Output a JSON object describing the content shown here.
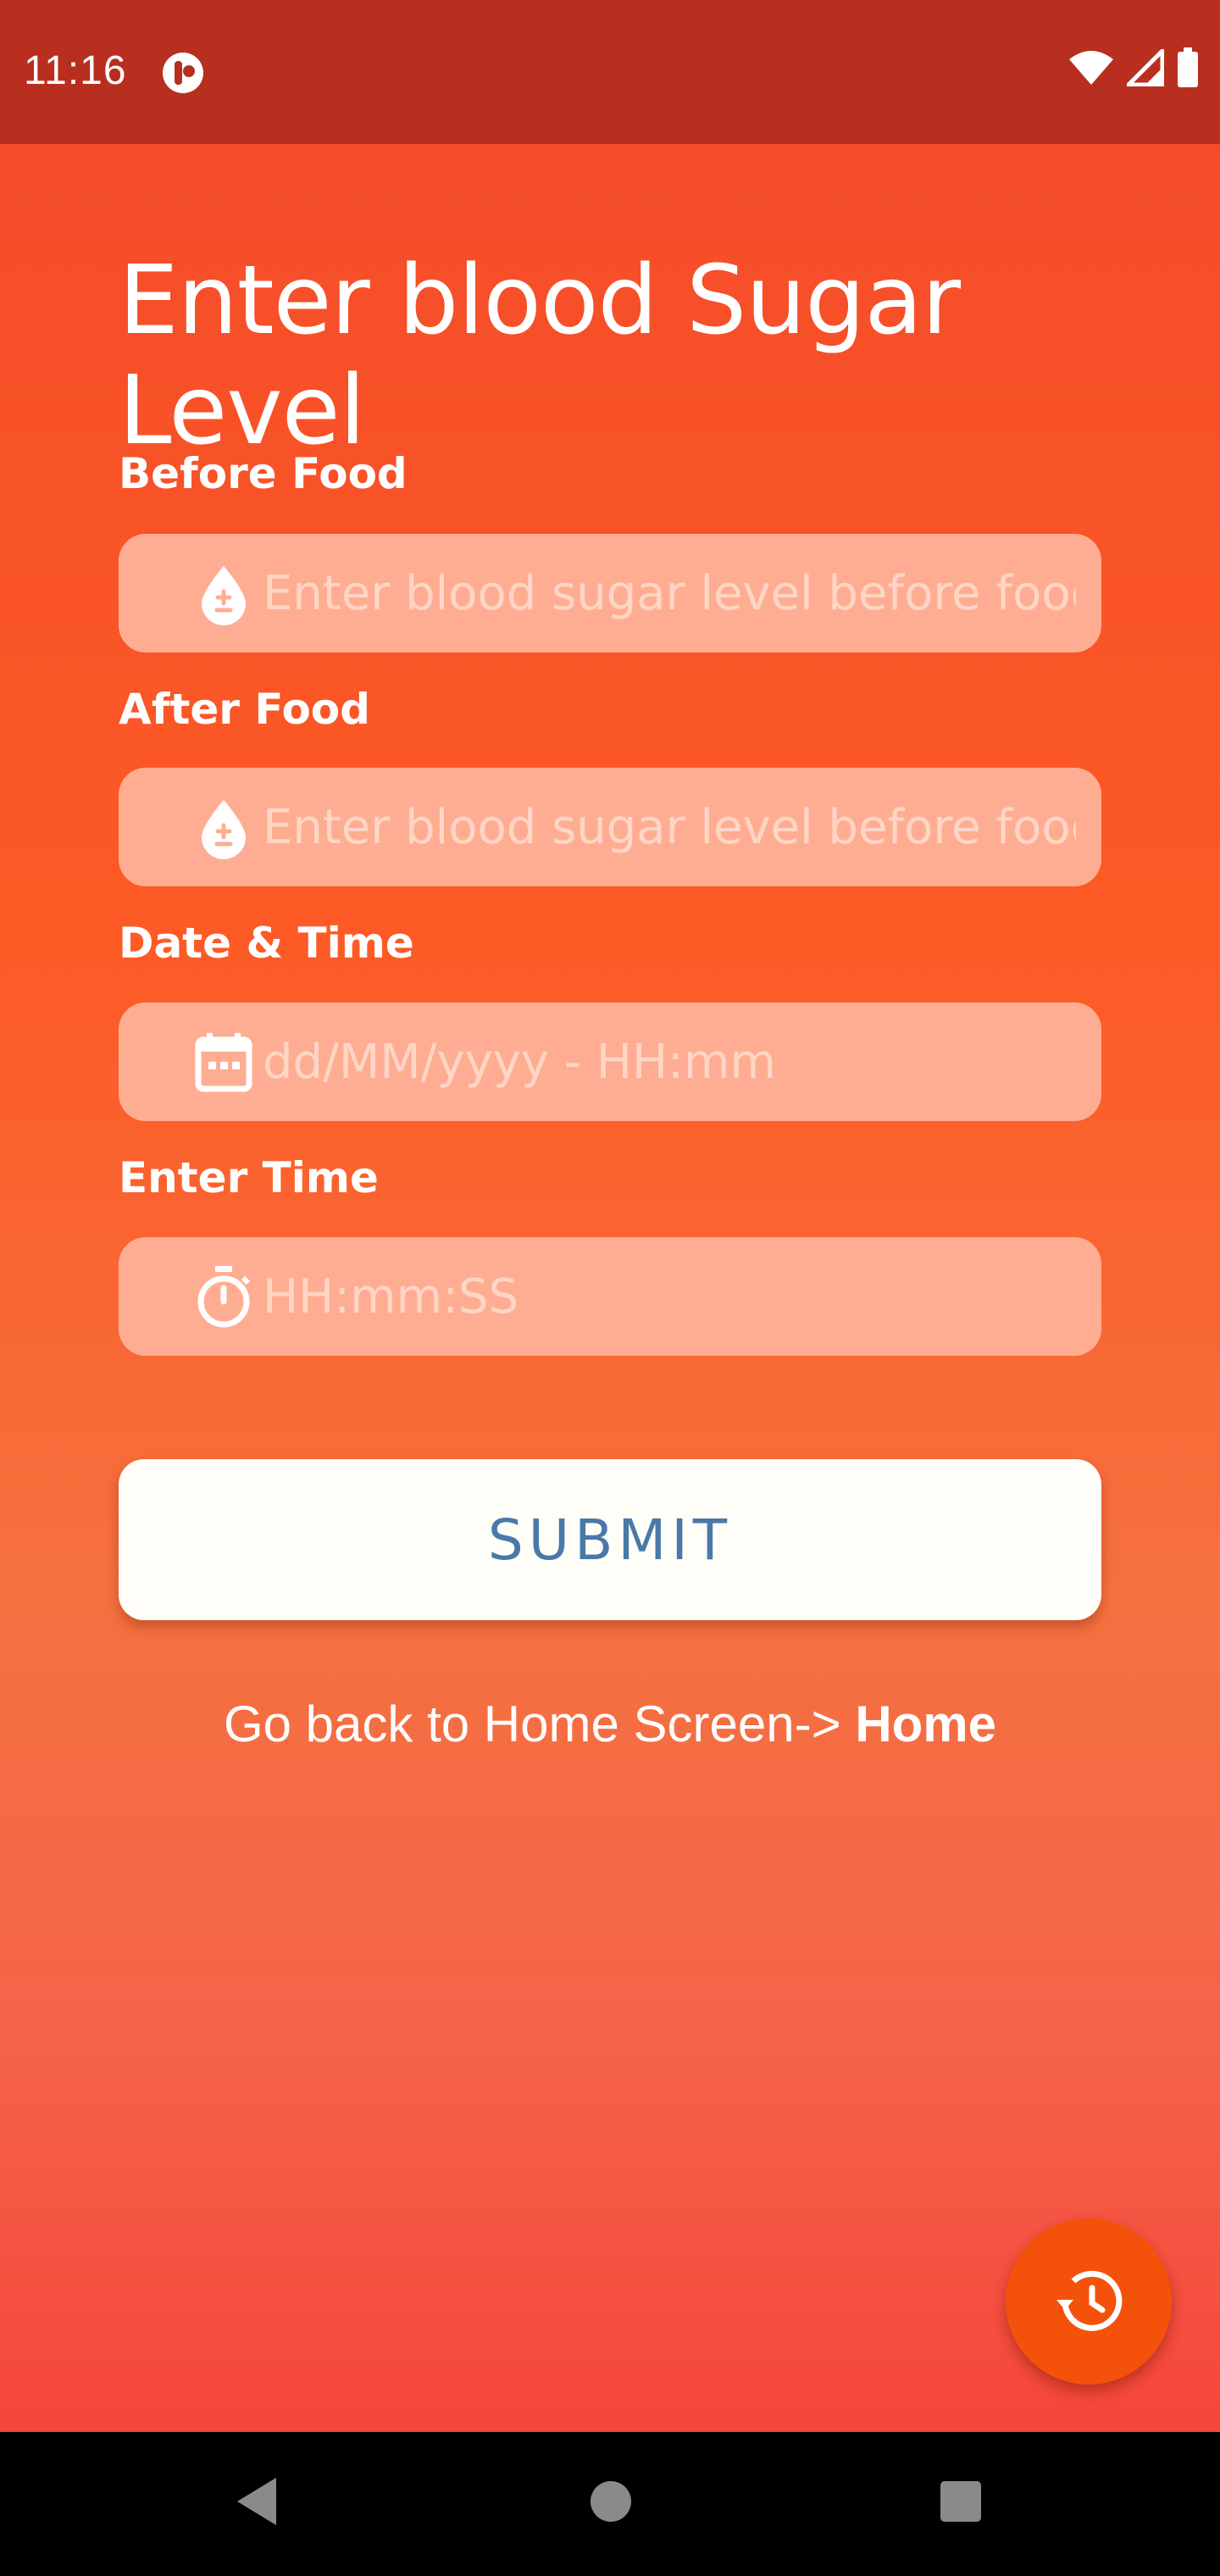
{
  "status_bar": {
    "time": "11:16",
    "icons": [
      "notification-app-icon",
      "wifi-icon",
      "signal-icon",
      "battery-icon"
    ]
  },
  "page": {
    "title": "Enter blood Sugar Level"
  },
  "form": {
    "before_food": {
      "label": "Before Food",
      "placeholder": "Enter blood sugar level before food ...",
      "value": "",
      "icon": "blood-drop-icon"
    },
    "after_food": {
      "label": "After Food",
      "placeholder": "Enter blood sugar level before food ...",
      "value": "",
      "icon": "blood-drop-icon"
    },
    "date_time": {
      "label": "Date & Time",
      "placeholder": "dd/MM/yyyy - HH:mm",
      "value": "",
      "icon": "calendar-icon"
    },
    "enter_time": {
      "label": "Enter Time",
      "placeholder": "HH:mm:SS",
      "value": "",
      "icon": "stopwatch-icon"
    },
    "submit_label": "SUBMIT"
  },
  "footer": {
    "go_back_text": "Go back to Home Screen-> ",
    "home_link": "Home"
  },
  "fab": {
    "icon": "history-icon"
  },
  "nav_bar": {
    "icons": [
      "back-icon",
      "home-icon",
      "recents-icon"
    ]
  },
  "colors": {
    "status_bar": "#b82e1f",
    "field_bg": "#ffad92",
    "submit_text": "#4a79a8",
    "fab_bg": "#f4510b"
  }
}
